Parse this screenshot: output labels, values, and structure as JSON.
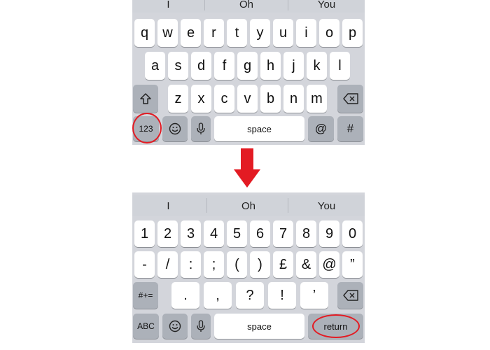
{
  "top_keyboard": {
    "suggestions": [
      "I",
      "Oh",
      "You"
    ],
    "row1": [
      "q",
      "w",
      "e",
      "r",
      "t",
      "y",
      "u",
      "i",
      "o",
      "p"
    ],
    "row2": [
      "a",
      "s",
      "d",
      "f",
      "g",
      "h",
      "j",
      "k",
      "l"
    ],
    "row3": [
      "z",
      "x",
      "c",
      "v",
      "b",
      "n",
      "m"
    ],
    "bottom_row": {
      "numbers_label": "123",
      "space_label": "space",
      "at_label": "@",
      "hash_label": "#"
    }
  },
  "bottom_keyboard": {
    "suggestions": [
      "I",
      "Oh",
      "You"
    ],
    "row1": [
      "1",
      "2",
      "3",
      "4",
      "5",
      "6",
      "7",
      "8",
      "9",
      "0"
    ],
    "row2": [
      "-",
      "/",
      ":",
      ";",
      "(",
      ")",
      "£",
      "&",
      "@",
      "”"
    ],
    "row3": [
      ".",
      ",",
      "?",
      "!",
      "’"
    ],
    "symbols_label": "#+=",
    "bottom_row": {
      "abc_label": "ABC",
      "space_label": "space",
      "return_label": "return"
    }
  },
  "colors": {
    "keyboard_bg": "#d3d5db",
    "key_bg": "#ffffff",
    "function_key_bg": "#acb1b9",
    "highlight_circle": "#e31b23",
    "arrow": "#e31b23"
  },
  "icons": {
    "shift": "shift-icon",
    "backspace": "backspace-icon",
    "emoji": "emoji-icon",
    "dictation": "microphone-icon",
    "arrow": "arrow-down-icon"
  }
}
